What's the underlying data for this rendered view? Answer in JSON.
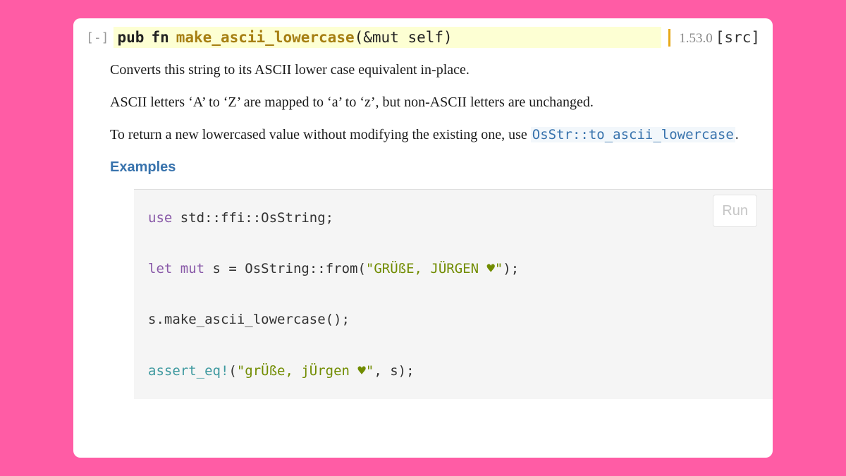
{
  "header": {
    "collapse": "[-]",
    "kw_pub": "pub",
    "kw_fn": "fn",
    "fn_name": "make_ascii_lowercase",
    "fn_args": "(&mut self)",
    "version": "1.53.0",
    "src": "[src]"
  },
  "description": {
    "p1": "Converts this string to its ASCII lower case equivalent in-place.",
    "p2": "ASCII letters ‘A’ to ‘Z’ are mapped to ‘a’ to ‘z’, but non-ASCII letters are unchanged.",
    "p3_pre": "To return a new lowercased value without modifying the existing one, use ",
    "p3_link": "OsStr::to_ascii_lowercase",
    "p3_post": "."
  },
  "examples_heading": "Examples",
  "run_label": "Run",
  "code": {
    "l1_use": "use",
    "l1_rest": " std::ffi::OsString;",
    "l2_let": "let",
    "l2_mut": "mut",
    "l2_mid": " s = OsString::from(",
    "l2_str": "\"GRÜßE, JÜRGEN ♥\"",
    "l2_end": ");",
    "l3": "s.make_ascii_lowercase();",
    "l4_macro": "assert_eq!",
    "l4_open": "(",
    "l4_str": "\"grÜße, jÜrgen ♥\"",
    "l4_end": ", s);"
  }
}
